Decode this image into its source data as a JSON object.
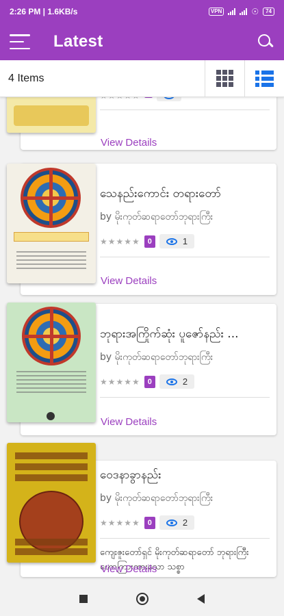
{
  "status_bar": {
    "time": "2:26 PM | 1.6KB/s",
    "vpn": "VPN",
    "battery": "74"
  },
  "app_bar": {
    "title": "Latest",
    "menu_icon": "hamburger-menu-icon",
    "search_icon": "search-icon"
  },
  "toolbar": {
    "items_count": "4 Items",
    "grid_view_icon": "grid-view-icon",
    "list_view_icon": "list-view-icon",
    "active_view": "list"
  },
  "books": [
    {
      "title": "",
      "author": "",
      "rating": "",
      "views": "",
      "view_details": "View Details"
    },
    {
      "title": "သေနည်းကောင်း တရားတော်",
      "author": "by မိုးကုတ်ဆရာတော်ဘုရားကြီး",
      "rating": "0",
      "views": "1",
      "view_details": "View Details"
    },
    {
      "title": "ဘုရားအကြိုက်ဆုံး ပူဇော်နည်း ...",
      "author": "by မိုးကုတ်ဆရာတော်ဘုရားကြီး",
      "rating": "0",
      "views": "2",
      "view_details": "View Details"
    },
    {
      "title": "ဝေဒနာခွာနည်း",
      "author": "by မိုးကုတ်ဆရာတော်ဘုရားကြီး",
      "rating": "0",
      "views": "2",
      "description": "ကျေးဇူးတော်ရှင် မိုးကုတ်ဆရာတော် ဘုရားကြီး ဟောကြားထားသော သစ္စာ",
      "view_details": "View Details"
    }
  ],
  "colors": {
    "primary": "#9b3fbf",
    "accent_blue": "#1a73e8",
    "background": "#f2f2f2"
  },
  "nav_bar": {
    "recents_icon": "square-recents-icon",
    "home_icon": "circle-home-icon",
    "back_icon": "triangle-back-icon"
  }
}
